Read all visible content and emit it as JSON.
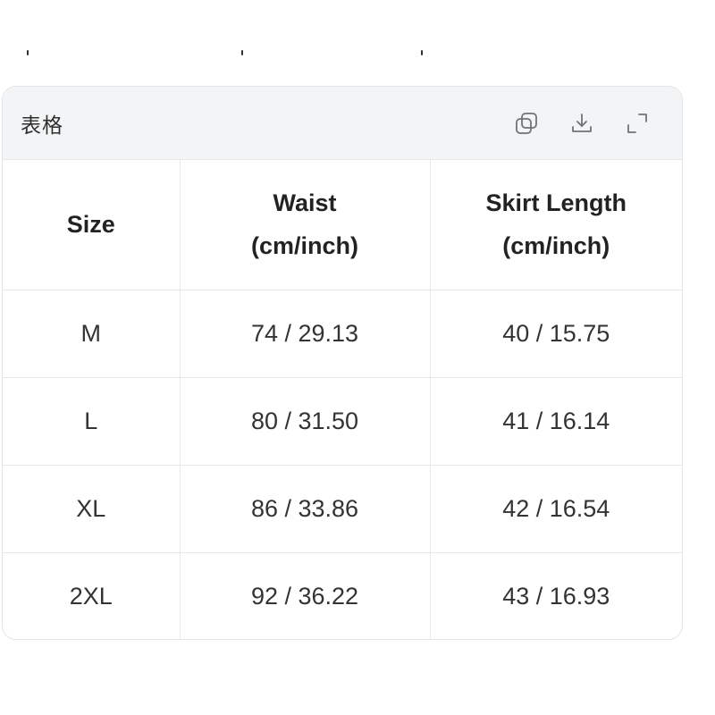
{
  "card": {
    "title": "表格",
    "tools": [
      {
        "name": "copy",
        "icon": "copy-icon"
      },
      {
        "name": "download",
        "icon": "download-icon"
      },
      {
        "name": "expand",
        "icon": "expand-icon"
      }
    ]
  },
  "table": {
    "headers": [
      {
        "line1": "Size",
        "line2": ""
      },
      {
        "line1": "Waist",
        "line2": "(cm/inch)"
      },
      {
        "line1": "Skirt Length",
        "line2": "(cm/inch)"
      }
    ],
    "rows": [
      [
        "M",
        "74 / 29.13",
        "40 / 15.75"
      ],
      [
        "L",
        "80 / 31.50",
        "41 / 16.14"
      ],
      [
        "XL",
        "86 / 33.86",
        "42 / 16.54"
      ],
      [
        "2XL",
        "92 / 36.22",
        "43 / 16.93"
      ]
    ]
  }
}
